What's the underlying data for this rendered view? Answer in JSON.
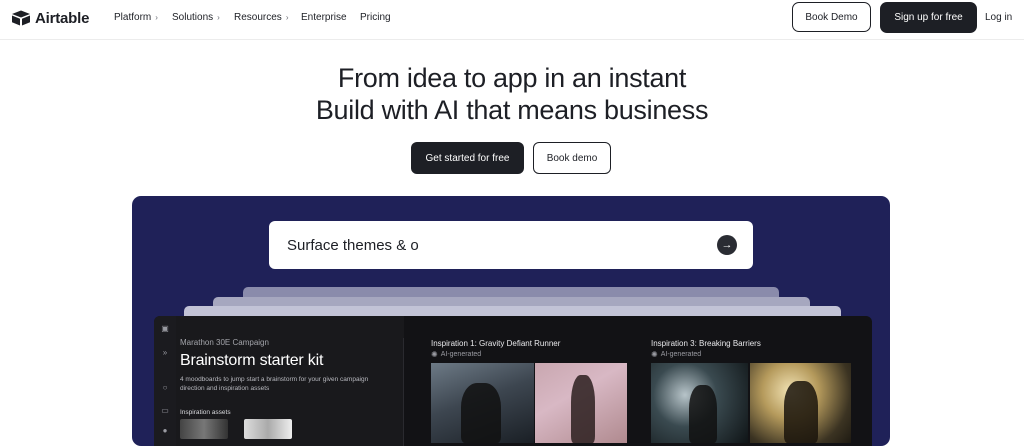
{
  "nav": {
    "logo_text": "Airtable",
    "items": [
      {
        "label": "Platform",
        "chevron": true
      },
      {
        "label": "Solutions",
        "chevron": true
      },
      {
        "label": "Resources",
        "chevron": true
      },
      {
        "label": "Enterprise",
        "chevron": false
      },
      {
        "label": "Pricing",
        "chevron": false
      }
    ],
    "book_demo": "Book Demo",
    "signup": "Sign up for free",
    "login": "Log in"
  },
  "hero": {
    "line1": "From idea to app in an instant",
    "line2": "Build with AI that means business",
    "primary_cta": "Get started for free",
    "secondary_cta": "Book demo"
  },
  "showcase": {
    "prompt_text": "Surface themes & o",
    "submit_icon": "arrow-right-icon",
    "kit": {
      "campaign": "Marathon 30E Campaign",
      "title": "Brainstorm starter kit",
      "description": "4 moodboards to jump start a brainstorm for your given campaign direction and inspiration assets",
      "assets_label": "Inspiration assets"
    },
    "inspirations": [
      {
        "title": "Inspiration 1: Gravity Defiant Runner",
        "tag": "AI-generated"
      },
      {
        "title": "Inspiration 3: Breaking Barriers",
        "tag": "AI-generated"
      }
    ]
  },
  "colors": {
    "brand_dark": "#1d1f25",
    "showcase_bg": "#1f2158",
    "app_bg": "#121215"
  }
}
